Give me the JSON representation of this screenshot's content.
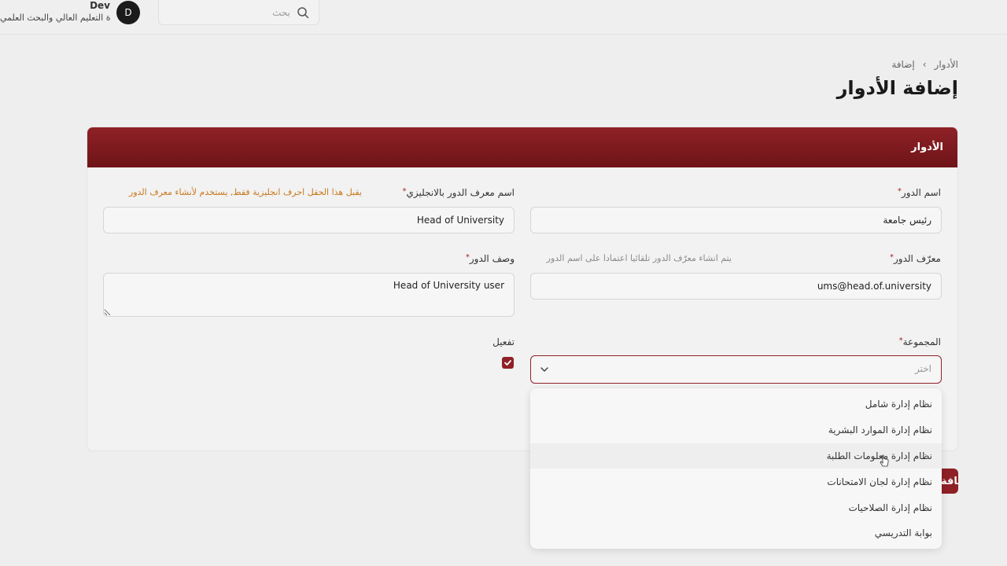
{
  "header": {
    "user_name": "Dev",
    "user_org": "وزارة التعليم العالي والبحث العلمي",
    "avatar_initial": "D",
    "search_placeholder": "بحث"
  },
  "breadcrumb": {
    "parent": "الأدوار",
    "separator": "›",
    "current": "إضافة"
  },
  "page_title": "إضافة الأدوار",
  "card": {
    "title": "الأدوار"
  },
  "form": {
    "role_name": {
      "label": "اسم الدور",
      "value": "رئيس جامعة"
    },
    "role_id_en": {
      "label": "اسم معرف الدور بالانجليزي",
      "hint": "يقبل هذا الحقل احرف انجليزية فقط, يستخدم لأنشاء معرف الدور",
      "value": "Head of University"
    },
    "role_identifier": {
      "label": "معرّف الدور",
      "hint": "يتم انشاء معرّف الدور تلقائيا اعتمادا على اسم الدور",
      "value": "ums@head.of.university"
    },
    "role_description": {
      "label": "وصف الدور",
      "value": "Head of University user"
    },
    "group": {
      "label": "المجموعة",
      "placeholder": "اختر",
      "options": [
        "نظام إدارة شامل",
        "نظام إدارة الموارد البشرية",
        "نظام إدارة معلومات الطلبة",
        "نظام إدارة لجان الامتحانات",
        "نظام إدارة الصلاحيات",
        "بوابة التدريسي"
      ]
    },
    "activate": {
      "label": "تفعيل",
      "checked": true
    },
    "required_mark": "*"
  },
  "submit_label": "إضافة",
  "colors": {
    "brand": "#8e2126",
    "hint_orange": "#c9781f"
  }
}
